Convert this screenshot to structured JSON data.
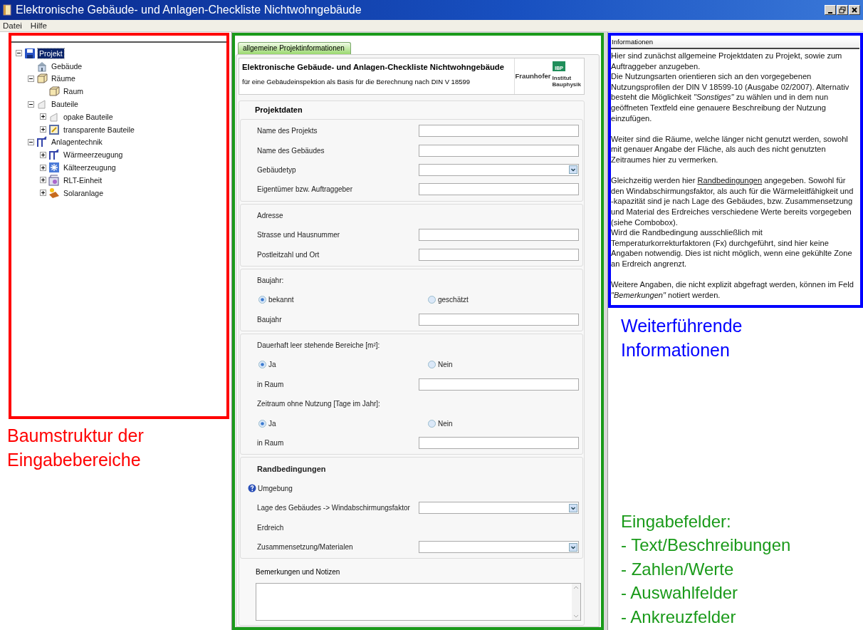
{
  "window": {
    "title": "Elektronische Gebäude- und Anlagen-Checkliste Nichtwohngebäude"
  },
  "menu": [
    "Datei",
    "Hilfe"
  ],
  "tree": {
    "nodes": [
      {
        "label": "Projekt",
        "kind": "project",
        "selected": true,
        "expanded": true,
        "children": [
          {
            "label": "Gebäude",
            "kind": "building",
            "selected": false
          },
          {
            "label": "Räume",
            "kind": "rooms",
            "selected": false,
            "expanded": true,
            "children": [
              {
                "label": "Raum",
                "kind": "room",
                "selected": false
              }
            ]
          },
          {
            "label": "Bauteile",
            "kind": "components",
            "selected": false,
            "expanded": true,
            "children": [
              {
                "label": "opake Bauteile",
                "kind": "opaque",
                "selected": false,
                "expanded": false
              },
              {
                "label": "transparente Bauteile",
                "kind": "transparent",
                "selected": false,
                "expanded": false
              }
            ]
          },
          {
            "label": "Anlagentechnik",
            "kind": "systems",
            "selected": false,
            "expanded": true,
            "children": [
              {
                "label": "Wärmeerzeugung",
                "kind": "heating",
                "selected": false,
                "expanded": false
              },
              {
                "label": "Kälteerzeugung",
                "kind": "cooling",
                "selected": false,
                "expanded": false
              },
              {
                "label": "RLT-Einheit",
                "kind": "ventilation",
                "selected": false,
                "expanded": false
              },
              {
                "label": "Solaranlage",
                "kind": "solar",
                "selected": false,
                "expanded": false
              }
            ]
          }
        ]
      }
    ],
    "annotation": {
      "color": "#ff0000",
      "lines": [
        "Baumstruktur der",
        "Eingabebereiche"
      ]
    }
  },
  "form": {
    "tab": {
      "label": "allgemeine Projektinformationen",
      "selected": true
    },
    "header": {
      "title": "Elektronische Gebäude- und Anlagen-Checkliste Nichtwohngebäude",
      "subtitle": "für eine Gebäudeinspektion als Basis für die Berechnung nach DIN V 18599",
      "logo": {
        "badge": "IBP",
        "brand": "Fraunhofer",
        "lines": [
          "Institut",
          "Bauphysik"
        ]
      }
    },
    "heading": "Projektdaten",
    "groups": [
      {
        "rows": [
          {
            "kind": "text",
            "label": "Name des Projekts"
          },
          {
            "kind": "text",
            "label": "Name des Gebäudes"
          },
          {
            "kind": "combo",
            "label": "Gebäudetyp"
          },
          {
            "kind": "text",
            "label": "Eigentümer bzw. Auftraggeber"
          }
        ]
      },
      {
        "rows": [
          {
            "kind": "label",
            "label": "Adresse"
          },
          {
            "kind": "text",
            "label": "Strasse und Hausnummer"
          },
          {
            "kind": "text",
            "label": "Postleitzahl und Ort"
          }
        ]
      },
      {
        "rows": [
          {
            "kind": "label",
            "label": "Baujahr:"
          },
          {
            "kind": "radio",
            "options": [
              {
                "label": "bekannt",
                "selected": true
              },
              {
                "label": "geschätzt",
                "selected": false
              }
            ]
          },
          {
            "kind": "text",
            "label": "Baujahr"
          }
        ]
      },
      {
        "rows": [
          {
            "kind": "label",
            "label": "Dauerhaft leer stehende Bereiche [m²]:"
          },
          {
            "kind": "radio",
            "options": [
              {
                "label": "Ja",
                "selected": true
              },
              {
                "label": "Nein",
                "selected": false
              }
            ]
          },
          {
            "kind": "text",
            "label": "in Raum"
          },
          {
            "kind": "label",
            "label": "Zeitraum ohne Nutzung [Tage im Jahr]:"
          },
          {
            "kind": "radio",
            "options": [
              {
                "label": "Ja",
                "selected": true
              },
              {
                "label": "Nein",
                "selected": false
              }
            ]
          },
          {
            "kind": "text",
            "label": "in Raum"
          }
        ]
      },
      {
        "rows": [
          {
            "kind": "heading",
            "label": "Randbedingungen"
          },
          {
            "kind": "help",
            "label": "Umgebung"
          },
          {
            "kind": "combo",
            "label": "Lage des Gebäudes -> Windabschirmungsfaktor"
          },
          {
            "kind": "label",
            "label": "Erdreich"
          },
          {
            "kind": "combo",
            "label": "Zusammensetzung/Materialen"
          }
        ]
      }
    ],
    "notes": {
      "label": "Bemerkungen und Notizen"
    },
    "annotation": {
      "color": "#1a9a1a",
      "lines": [
        "Eingabefelder:",
        "- Text/Beschreibungen",
        "- Zahlen/Werte",
        "- Auswahlfelder",
        "- Ankreuzfelder"
      ]
    }
  },
  "info": {
    "title": "Informationen",
    "blocks": [
      [
        "Hier sind zunächst allgemeine Projektdaten zu Projekt, sowie zum Auftraggeber anzugeben.",
        "Die Nutzungsarten orientieren sich an den vorgegebenen Nutzungsprofilen der DIN V 18599-10 (Ausgabe 02/2007). Alternativ besteht die Möglichkeit *\"Sonstiges\"* zu wählen und in dem nun geöffneten Textfeld eine genauere Beschreibung der Nutzung einzufügen."
      ],
      [
        "Weiter sind die Räume, welche länger nicht genutzt werden, sowohl mit genauer Angabe der Fläche, als auch des nicht genutzten Zeitraumes hier zu vermerken."
      ],
      [
        {
          "before": "Gleichzeitig werden hier ",
          "link": "Randbedingungen",
          "after": " angegeben. Sowohl für den Windabschirmungsfaktor, als auch für die Wärmeleitfähigkeit und -kapazität sind je nach Lage des Gebäudes, bzw. Zusammensetzung und Material des Erdreiches verschiedene Werte bereits vorgegeben (siehe Combobox)."
        },
        "Wird die Randbedingung ausschließlich mit Temperaturkorrekturfaktoren (Fx) durchgeführt, sind hier keine Angaben notwendig. Dies ist nicht möglich, wenn eine gekühlte Zone an Erdreich angrenzt."
      ],
      [
        "Weitere Angaben, die nicht explizit abgefragt werden, können im Feld *\"Bemerkungen\"* notiert werden."
      ]
    ],
    "annotation": {
      "color": "#0000ff",
      "lines": [
        "Weiterführende",
        "Informationen"
      ]
    }
  }
}
